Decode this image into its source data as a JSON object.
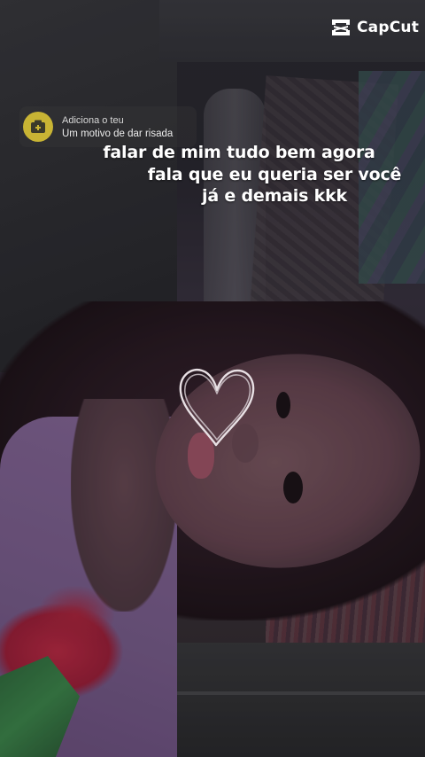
{
  "watermark": {
    "brand": "CapCut",
    "icon": "capcut-logo-icon"
  },
  "overlay_chip": {
    "icon": "camera-plus-icon",
    "line1": "Adiciona o teu",
    "line2": "Um motivo de dar risada"
  },
  "lyrics": {
    "lines": [
      "falar de mim tudo bem agora",
      "fala que eu queria ser você",
      "já e demais kkk"
    ]
  },
  "sticker": {
    "icon": "heart-outline-icon"
  },
  "colors": {
    "chip_icon": "#c8b434",
    "text": "#ffffff"
  }
}
